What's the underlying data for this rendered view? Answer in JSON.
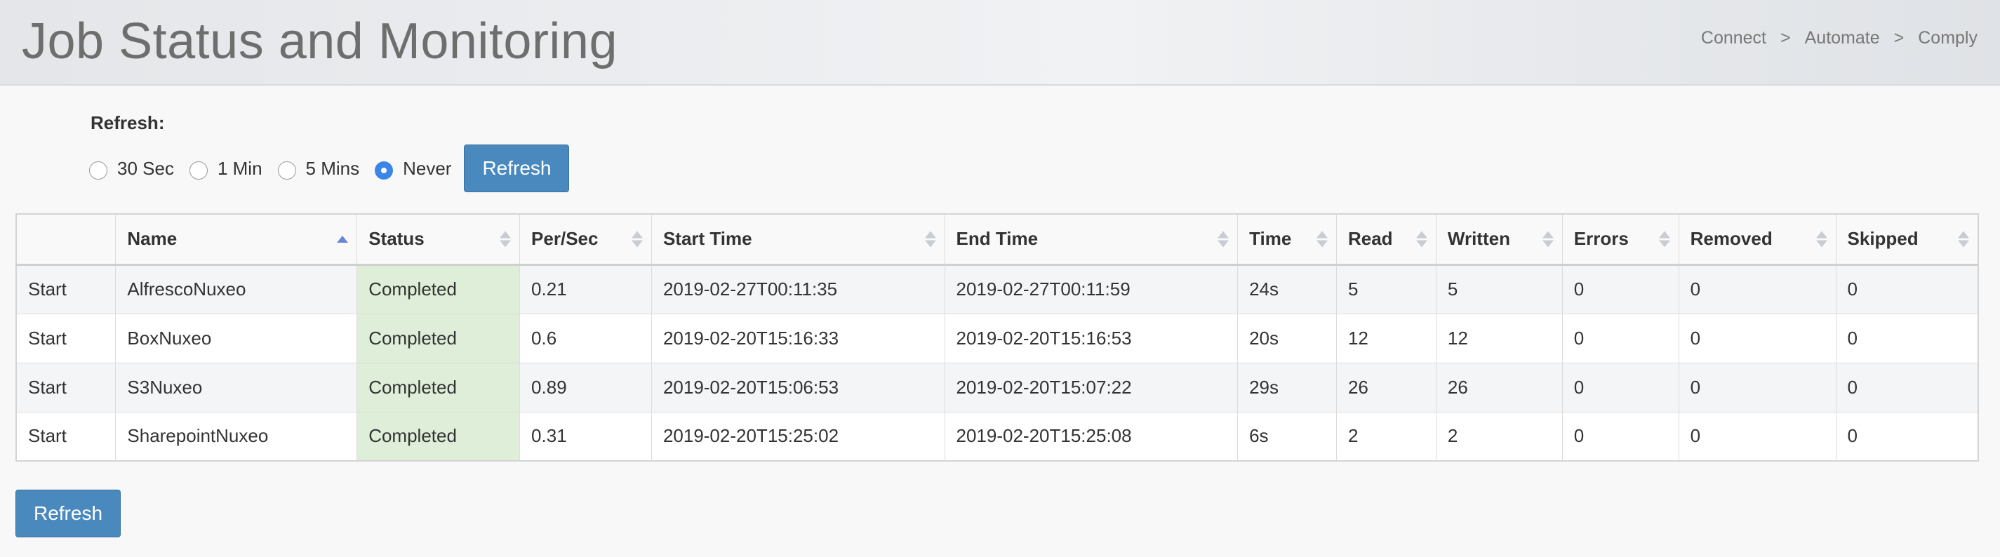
{
  "header": {
    "title": "Job Status and Monitoring",
    "breadcrumb": [
      "Connect",
      "Automate",
      "Comply"
    ],
    "separator": ">"
  },
  "refresh": {
    "label": "Refresh:",
    "options": [
      {
        "label": "30 Sec",
        "checked": false
      },
      {
        "label": "1 Min",
        "checked": false
      },
      {
        "label": "5 Mins",
        "checked": false
      },
      {
        "label": "Never",
        "checked": true
      }
    ],
    "button_label": "Refresh"
  },
  "table": {
    "columns": [
      "",
      "Name",
      "Status",
      "Per/Sec",
      "Start Time",
      "End Time",
      "Time",
      "Read",
      "Written",
      "Errors",
      "Removed",
      "Skipped"
    ],
    "sorted_column": "Name",
    "sort_direction": "ascending",
    "rows": [
      {
        "action": "Start",
        "name": "AlfrescoNuxeo",
        "status": "Completed",
        "per_sec": "0.21",
        "start": "2019-02-27T00:11:35",
        "end": "2019-02-27T00:11:59",
        "time": "24s",
        "read": "5",
        "written": "5",
        "errors": "0",
        "removed": "0",
        "skipped": "0"
      },
      {
        "action": "Start",
        "name": "BoxNuxeo",
        "status": "Completed",
        "per_sec": "0.6",
        "start": "2019-02-20T15:16:33",
        "end": "2019-02-20T15:16:53",
        "time": "20s",
        "read": "12",
        "written": "12",
        "errors": "0",
        "removed": "0",
        "skipped": "0"
      },
      {
        "action": "Start",
        "name": "S3Nuxeo",
        "status": "Completed",
        "per_sec": "0.89",
        "start": "2019-02-20T15:06:53",
        "end": "2019-02-20T15:07:22",
        "time": "29s",
        "read": "26",
        "written": "26",
        "errors": "0",
        "removed": "0",
        "skipped": "0"
      },
      {
        "action": "Start",
        "name": "SharepointNuxeo",
        "status": "Completed",
        "per_sec": "0.31",
        "start": "2019-02-20T15:25:02",
        "end": "2019-02-20T15:25:08",
        "time": "6s",
        "read": "2",
        "written": "2",
        "errors": "0",
        "removed": "0",
        "skipped": "0"
      }
    ]
  },
  "footer": {
    "refresh_button_label": "Refresh"
  },
  "colors": {
    "accent_button": "#4a89be",
    "link": "#3d7fb8",
    "status_completed_bg": "#dfeed8",
    "radio_checked": "#3b85e8"
  }
}
